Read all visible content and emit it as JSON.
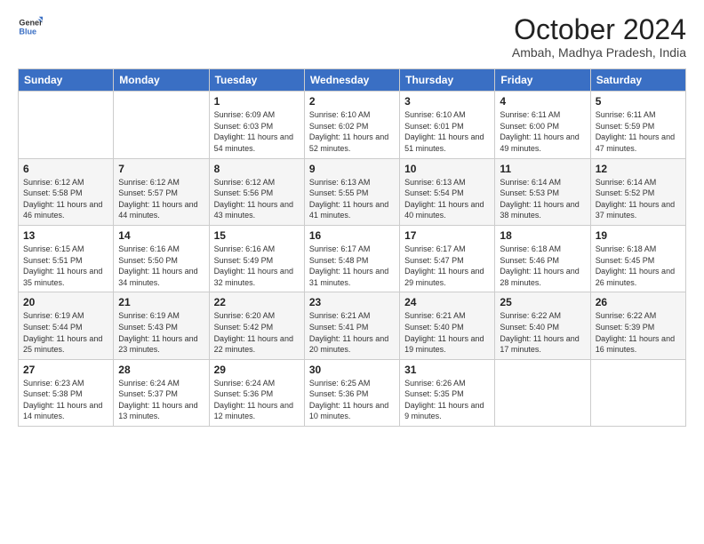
{
  "logo": {
    "line1": "General",
    "line2": "Blue"
  },
  "title": "October 2024",
  "location": "Ambah, Madhya Pradesh, India",
  "weekdays": [
    "Sunday",
    "Monday",
    "Tuesday",
    "Wednesday",
    "Thursday",
    "Friday",
    "Saturday"
  ],
  "weeks": [
    [
      {
        "day": "",
        "info": ""
      },
      {
        "day": "",
        "info": ""
      },
      {
        "day": "1",
        "info": "Sunrise: 6:09 AM\nSunset: 6:03 PM\nDaylight: 11 hours and 54 minutes."
      },
      {
        "day": "2",
        "info": "Sunrise: 6:10 AM\nSunset: 6:02 PM\nDaylight: 11 hours and 52 minutes."
      },
      {
        "day": "3",
        "info": "Sunrise: 6:10 AM\nSunset: 6:01 PM\nDaylight: 11 hours and 51 minutes."
      },
      {
        "day": "4",
        "info": "Sunrise: 6:11 AM\nSunset: 6:00 PM\nDaylight: 11 hours and 49 minutes."
      },
      {
        "day": "5",
        "info": "Sunrise: 6:11 AM\nSunset: 5:59 PM\nDaylight: 11 hours and 47 minutes."
      }
    ],
    [
      {
        "day": "6",
        "info": "Sunrise: 6:12 AM\nSunset: 5:58 PM\nDaylight: 11 hours and 46 minutes."
      },
      {
        "day": "7",
        "info": "Sunrise: 6:12 AM\nSunset: 5:57 PM\nDaylight: 11 hours and 44 minutes."
      },
      {
        "day": "8",
        "info": "Sunrise: 6:12 AM\nSunset: 5:56 PM\nDaylight: 11 hours and 43 minutes."
      },
      {
        "day": "9",
        "info": "Sunrise: 6:13 AM\nSunset: 5:55 PM\nDaylight: 11 hours and 41 minutes."
      },
      {
        "day": "10",
        "info": "Sunrise: 6:13 AM\nSunset: 5:54 PM\nDaylight: 11 hours and 40 minutes."
      },
      {
        "day": "11",
        "info": "Sunrise: 6:14 AM\nSunset: 5:53 PM\nDaylight: 11 hours and 38 minutes."
      },
      {
        "day": "12",
        "info": "Sunrise: 6:14 AM\nSunset: 5:52 PM\nDaylight: 11 hours and 37 minutes."
      }
    ],
    [
      {
        "day": "13",
        "info": "Sunrise: 6:15 AM\nSunset: 5:51 PM\nDaylight: 11 hours and 35 minutes."
      },
      {
        "day": "14",
        "info": "Sunrise: 6:16 AM\nSunset: 5:50 PM\nDaylight: 11 hours and 34 minutes."
      },
      {
        "day": "15",
        "info": "Sunrise: 6:16 AM\nSunset: 5:49 PM\nDaylight: 11 hours and 32 minutes."
      },
      {
        "day": "16",
        "info": "Sunrise: 6:17 AM\nSunset: 5:48 PM\nDaylight: 11 hours and 31 minutes."
      },
      {
        "day": "17",
        "info": "Sunrise: 6:17 AM\nSunset: 5:47 PM\nDaylight: 11 hours and 29 minutes."
      },
      {
        "day": "18",
        "info": "Sunrise: 6:18 AM\nSunset: 5:46 PM\nDaylight: 11 hours and 28 minutes."
      },
      {
        "day": "19",
        "info": "Sunrise: 6:18 AM\nSunset: 5:45 PM\nDaylight: 11 hours and 26 minutes."
      }
    ],
    [
      {
        "day": "20",
        "info": "Sunrise: 6:19 AM\nSunset: 5:44 PM\nDaylight: 11 hours and 25 minutes."
      },
      {
        "day": "21",
        "info": "Sunrise: 6:19 AM\nSunset: 5:43 PM\nDaylight: 11 hours and 23 minutes."
      },
      {
        "day": "22",
        "info": "Sunrise: 6:20 AM\nSunset: 5:42 PM\nDaylight: 11 hours and 22 minutes."
      },
      {
        "day": "23",
        "info": "Sunrise: 6:21 AM\nSunset: 5:41 PM\nDaylight: 11 hours and 20 minutes."
      },
      {
        "day": "24",
        "info": "Sunrise: 6:21 AM\nSunset: 5:40 PM\nDaylight: 11 hours and 19 minutes."
      },
      {
        "day": "25",
        "info": "Sunrise: 6:22 AM\nSunset: 5:40 PM\nDaylight: 11 hours and 17 minutes."
      },
      {
        "day": "26",
        "info": "Sunrise: 6:22 AM\nSunset: 5:39 PM\nDaylight: 11 hours and 16 minutes."
      }
    ],
    [
      {
        "day": "27",
        "info": "Sunrise: 6:23 AM\nSunset: 5:38 PM\nDaylight: 11 hours and 14 minutes."
      },
      {
        "day": "28",
        "info": "Sunrise: 6:24 AM\nSunset: 5:37 PM\nDaylight: 11 hours and 13 minutes."
      },
      {
        "day": "29",
        "info": "Sunrise: 6:24 AM\nSunset: 5:36 PM\nDaylight: 11 hours and 12 minutes."
      },
      {
        "day": "30",
        "info": "Sunrise: 6:25 AM\nSunset: 5:36 PM\nDaylight: 11 hours and 10 minutes."
      },
      {
        "day": "31",
        "info": "Sunrise: 6:26 AM\nSunset: 5:35 PM\nDaylight: 11 hours and 9 minutes."
      },
      {
        "day": "",
        "info": ""
      },
      {
        "day": "",
        "info": ""
      }
    ]
  ]
}
